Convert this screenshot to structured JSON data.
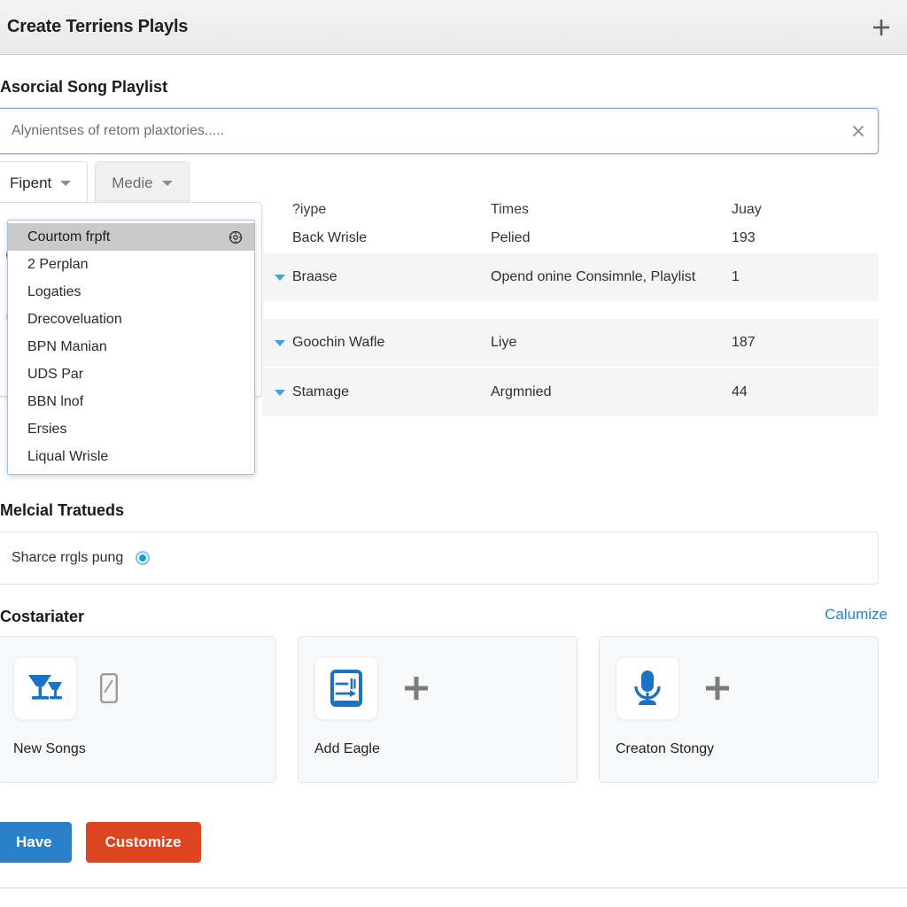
{
  "window": {
    "title": "Create Terriens Playls",
    "add_icon": "plus-icon"
  },
  "form": {
    "label": "Asorcial Song Playlist",
    "search": {
      "value": "",
      "placeholder": "Alynientses of retom plaxtories.....",
      "clear_icon": "close-icon"
    }
  },
  "tabs": [
    {
      "label": "Fipent",
      "active": true
    },
    {
      "label": "Medie",
      "active": false
    }
  ],
  "dropdown": {
    "items": [
      {
        "label": "Courtom frpft",
        "selected": true,
        "icon": "gear-icon"
      },
      {
        "label": "2 Perplan",
        "selected": false
      },
      {
        "label": "Logaties",
        "selected": false
      },
      {
        "label": "Drecoveluation",
        "selected": false
      },
      {
        "label": "BPN Manian",
        "selected": false
      },
      {
        "label": "UDS Par",
        "selected": false
      },
      {
        "label": "BBN lnof",
        "selected": false
      },
      {
        "label": "Ersies",
        "selected": false
      },
      {
        "label": "Liqual Wrisle",
        "selected": false
      }
    ]
  },
  "table": {
    "columns": [
      "?iype",
      "Times",
      "Juay"
    ],
    "rows": [
      {
        "type": "Back Wrisle",
        "times": "Pelied",
        "juay": "193",
        "caret": false,
        "striped": false
      },
      {
        "type": "Braase",
        "times": "Opend onine Consimnle, Playlist",
        "juay": "1",
        "caret": true,
        "striped": true
      },
      {
        "type": "Goochin Wafle",
        "times": "Liye",
        "juay": "187",
        "caret": true,
        "striped": true
      },
      {
        "type": "Stamage",
        "times": "Argmnied",
        "juay": "44",
        "caret": true,
        "striped": true
      }
    ]
  },
  "medial": {
    "heading": "Melcial Tratueds",
    "option_label": "Sharce rrgls pung",
    "radio_selected": true
  },
  "costariater": {
    "heading": "Costariater",
    "link": "Calumize",
    "cards": [
      {
        "label": "New Songs",
        "icon": "glasses-icon",
        "secondary_icon": "phone-icon"
      },
      {
        "label": "Add Eagle",
        "icon": "transfer-card-icon",
        "secondary_icon": "plus-icon"
      },
      {
        "label": "Creaton Stongy",
        "icon": "microphone-icon",
        "secondary_icon": "plus-icon"
      }
    ]
  },
  "footer": {
    "primary_label": "Have",
    "danger_label": "Customize"
  },
  "colors": {
    "accent_blue": "#2a7fc9",
    "danger_red": "#dc4520",
    "link_blue": "#2e7fc4",
    "caret_blue": "#46a0dd",
    "icon_blue": "#1a72c4"
  }
}
